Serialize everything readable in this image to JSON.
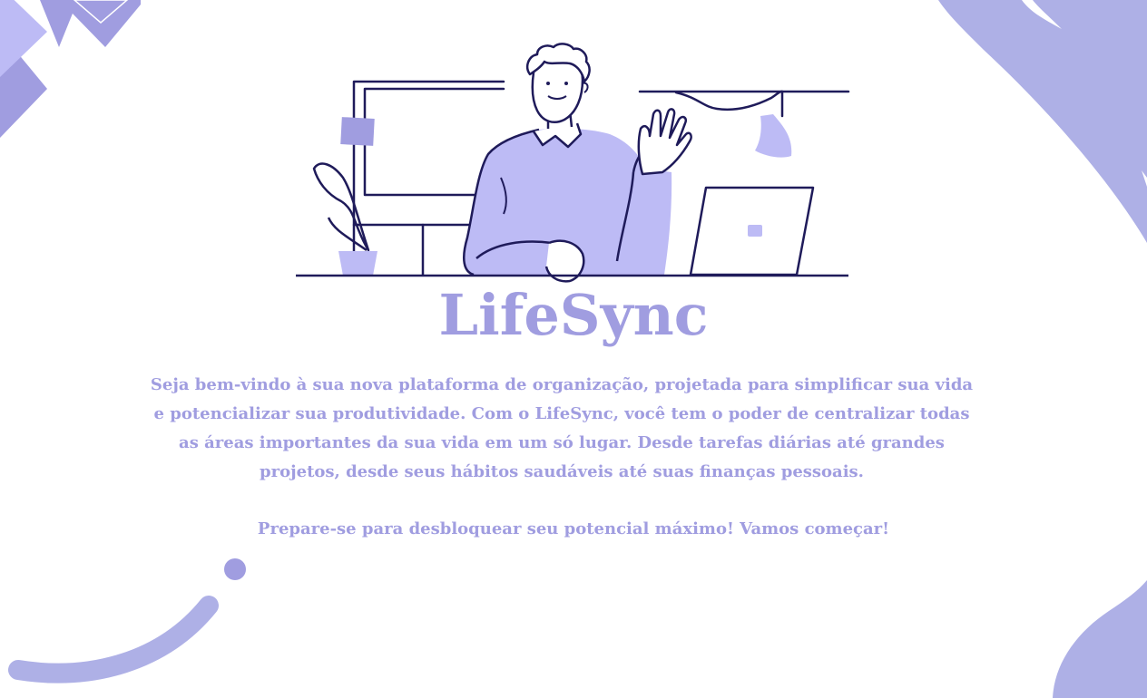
{
  "colors": {
    "accent": "#a09de0",
    "accent_light": "#bdbbf5",
    "accent_soft": "#aeb0e6",
    "outline": "#1f1b5a",
    "background": "#ffffff"
  },
  "illustration": {
    "icon": "man-waving-at-desk-illustration"
  },
  "app": {
    "title": "LifeSync"
  },
  "welcome": {
    "intro": "Seja bem-vindo à sua nova plataforma de organização, projetada para simplificar sua vida e potencializar sua produtividade. Com o LifeSync, você tem o poder de centralizar todas as áreas importantes da sua vida em um só lugar. Desde tarefas diárias até grandes projetos, desde seus hábitos saudáveis até suas finanças pessoais.",
    "call_to_action": "Prepare-se para desbloquear seu potencial máximo! Vamos começar!"
  }
}
